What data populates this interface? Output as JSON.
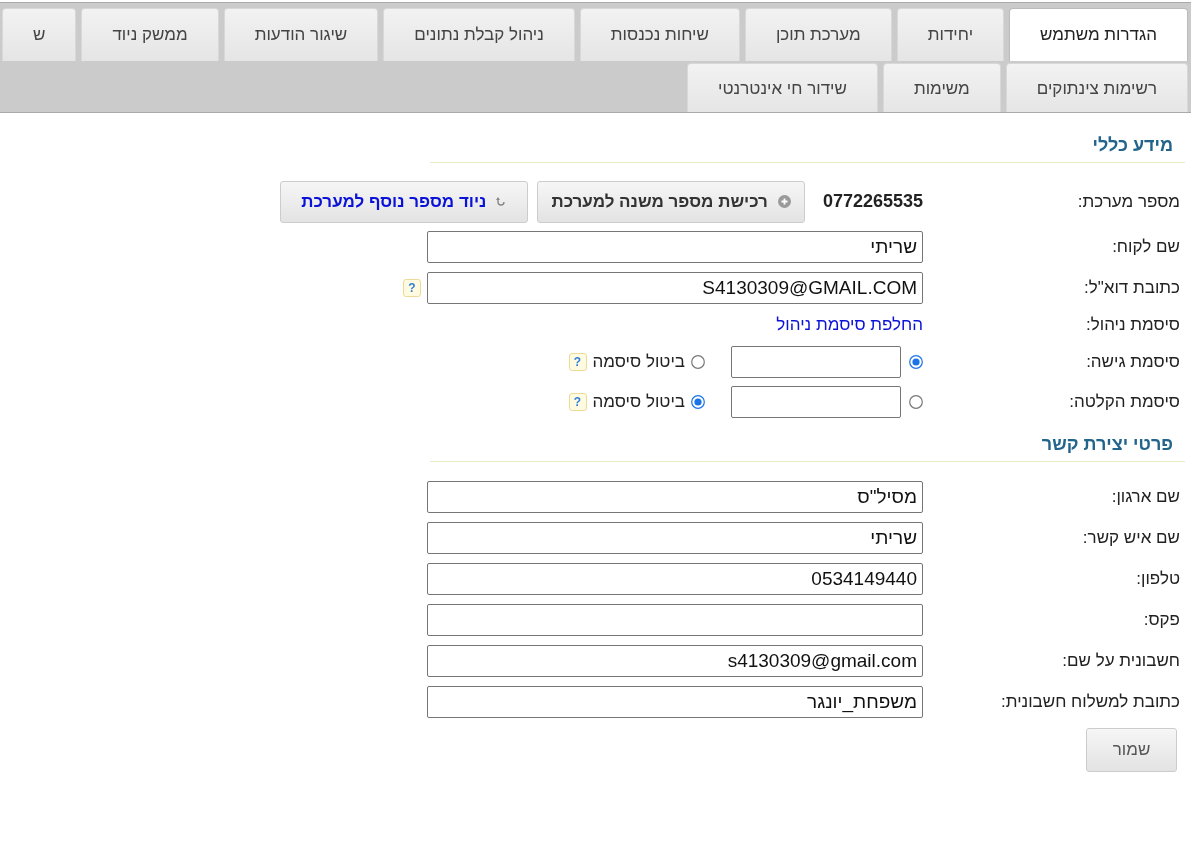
{
  "tab_rows": [
    {
      "tabs": [
        {
          "label": "הגדרות משתמש",
          "selected": true
        },
        {
          "label": "יחידות",
          "selected": false
        },
        {
          "label": "מערכת תוכן",
          "selected": false
        },
        {
          "label": "שיחות נכנסות",
          "selected": false
        },
        {
          "label": "ניהול קבלת נתונים",
          "selected": false
        },
        {
          "label": "שיגור הודעות",
          "selected": false
        },
        {
          "label": "ממשק ניוד",
          "selected": false
        },
        {
          "label": "ש",
          "selected": false
        }
      ]
    },
    {
      "tabs": [
        {
          "label": "רשימות צינתוקים",
          "selected": false
        },
        {
          "label": "משימות",
          "selected": false
        },
        {
          "label": "שידור חי אינטרנטי",
          "selected": false
        }
      ]
    }
  ],
  "general_info": {
    "title": "מידע כללי",
    "rows": [
      {
        "kind": "number",
        "label": "מספר מערכת:",
        "value": "0772265535",
        "buttons": [
          {
            "kind": "purchase",
            "label": "רכישת מספר משנה למערכת"
          },
          {
            "kind": "port",
            "label": "ניוד מספר נוסף למערכת"
          }
        ]
      },
      {
        "kind": "input",
        "label": "שם לקוח:",
        "value": "שריתי"
      },
      {
        "kind": "input",
        "label": "כתובת דוא\"ל:",
        "value": "S4130309@GMAIL.COM",
        "help": "?"
      },
      {
        "kind": "link",
        "label": "סיסמת ניהול:",
        "link": "החלפת סיסמת ניהול"
      },
      {
        "kind": "password",
        "label": "סיסמת גישה:",
        "set_selected": true,
        "disable": {
          "label": "ביטול סיסמה",
          "selected": false
        },
        "help": "?"
      },
      {
        "kind": "password",
        "label": "סיסמת הקלטה:",
        "set_selected": false,
        "disable": {
          "label": "ביטול סיסמה",
          "selected": true
        },
        "help": "?"
      }
    ]
  },
  "contact_info": {
    "title": "פרטי יצירת קשר",
    "rows": [
      {
        "kind": "input",
        "label": "שם ארגון:",
        "value": "מסיל\"ס"
      },
      {
        "kind": "input",
        "label": "שם איש קשר:",
        "value": "שריתי"
      },
      {
        "kind": "input",
        "label": "טלפון:",
        "value": "0534149440"
      },
      {
        "kind": "input",
        "label": "פקס:"
      },
      {
        "kind": "input",
        "label": "חשבונית על שם:",
        "value": "s4130309@gmail.com"
      },
      {
        "kind": "input",
        "label": "כתובת למשלוח חשבונית:",
        "value": "משפחת_יונגר"
      }
    ],
    "save_button": "שמור"
  }
}
